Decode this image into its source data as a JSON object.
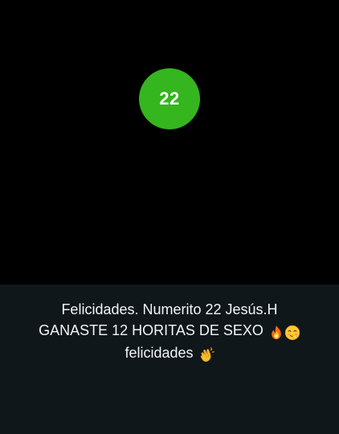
{
  "badge": {
    "number": "22",
    "color": "#35b51e"
  },
  "caption": {
    "line1": "Felicidades. Numerito 22 Jesús.H",
    "line2": "GANASTE 12 HORITAS DE SEXO",
    "line3": "felicidades",
    "line2_emojis": [
      "fire-emoji-icon",
      "blushing-smile-emoji-icon"
    ],
    "line3_emojis": [
      "clapping-hands-emoji-icon"
    ]
  },
  "colors": {
    "background": "#000000",
    "caption_panel": "#10171b",
    "caption_text": "#f2f4f5"
  }
}
